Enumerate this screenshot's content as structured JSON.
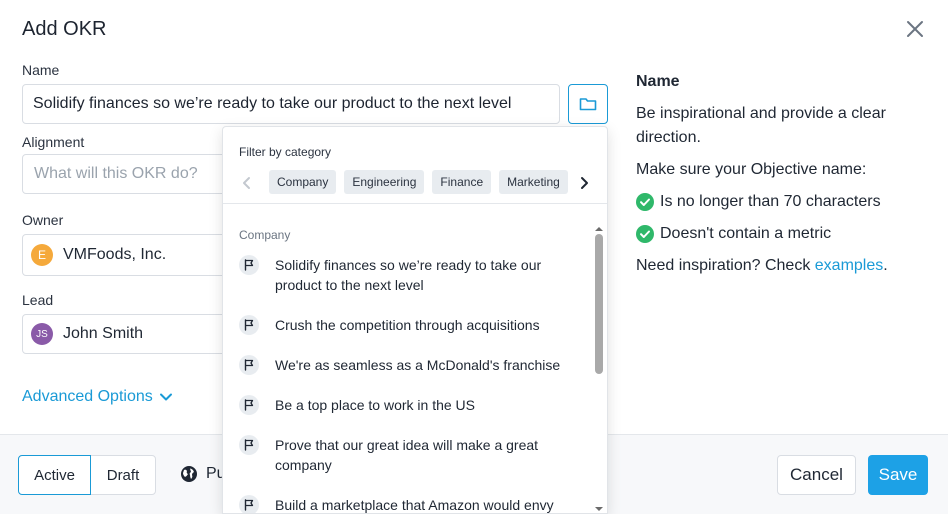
{
  "modal": {
    "title": "Add OKR"
  },
  "form": {
    "name_label": "Name",
    "name_value": "Solidify finances so we’re ready to take our product to the next level",
    "alignment_label": "Alignment",
    "alignment_placeholder": "What will this OKR do?",
    "owner_label": "Owner",
    "owner_value": "VMFoods, Inc.",
    "owner_avatar": "E",
    "lead_label": "Lead",
    "lead_value": "John Smith",
    "lead_avatar": "JS",
    "advanced_label": "Advanced Options"
  },
  "dropdown": {
    "filter_label": "Filter by category",
    "categories": [
      "Company",
      "Engineering",
      "Finance",
      "Marketing"
    ],
    "group_title": "Company",
    "options": [
      "Solidify finances so we’re ready to take our product to the next level",
      "Crush the competition through acquisitions",
      "We're as seamless as a McDonald's franchise",
      "Be a top place to work in the US",
      "Prove that our great idea will make a great company",
      "Build a marketplace that Amazon would envy"
    ]
  },
  "help": {
    "title": "Name",
    "line1": "Be inspirational and provide a clear direction.",
    "line2": "Make sure your Objective name:",
    "checks": [
      "Is no longer than 70 characters",
      "Doesn't contain a metric"
    ],
    "inspiration_prefix": "Need inspiration? Check ",
    "inspiration_link": "examples",
    "inspiration_suffix": "."
  },
  "footer": {
    "status_active": "Active",
    "status_draft": "Draft",
    "visibility": "Pu",
    "cancel": "Cancel",
    "save": "Save"
  },
  "colors": {
    "accent": "#1a9ad6",
    "save_bg": "#1da1e6",
    "check_green": "#2fb86a"
  }
}
